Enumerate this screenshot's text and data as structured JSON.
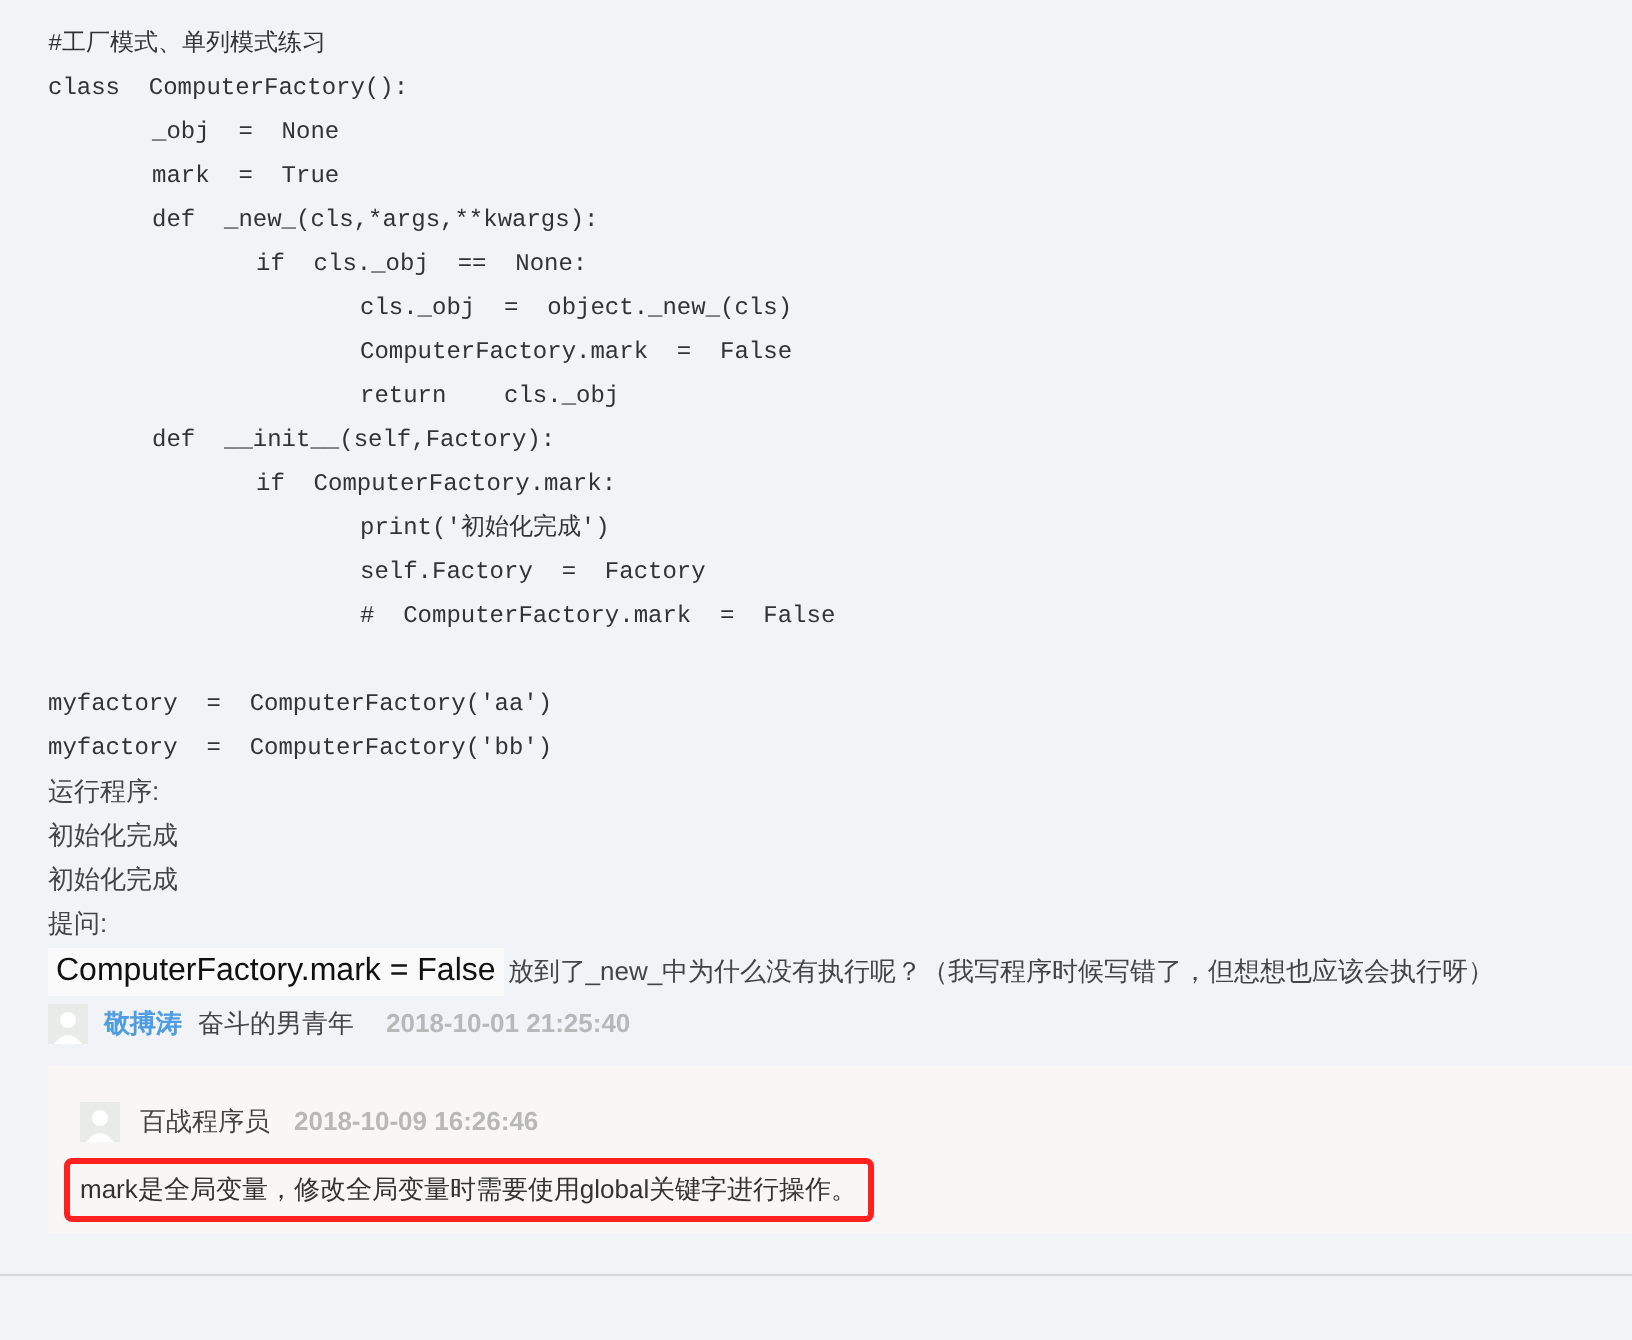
{
  "code_title": "#工厂模式、单列模式练习",
  "code": [
    {
      "text": "class  ComputerFactory():",
      "children": [
        {
          "text": "_obj  =  None"
        },
        {
          "text": "mark  =  True"
        },
        {
          "text": "def  _new_(cls,*args,**kwargs):",
          "children": [
            {
              "text": "if  cls._obj  ==  None:",
              "children": [
                {
                  "text": "cls._obj  =  object._new_(cls)"
                },
                {
                  "text": "ComputerFactory.mark  =  False"
                },
                {
                  "text": "return    cls._obj"
                }
              ]
            }
          ]
        },
        {
          "text": "def  __init__(self,Factory):",
          "children": [
            {
              "text": "if  ComputerFactory.mark:",
              "children": [
                {
                  "text": "print('初始化完成')"
                },
                {
                  "text": "self.Factory  =  Factory"
                },
                {
                  "text": "#  ComputerFactory.mark  =  False"
                }
              ]
            }
          ]
        }
      ]
    }
  ],
  "code_after": [
    "myfactory  =  ComputerFactory('aa')",
    "myfactory  =  ComputerFactory('bb')"
  ],
  "output_lines": [
    "运行程序:",
    "初始化完成",
    "初始化完成",
    "提问:"
  ],
  "question": {
    "highlight": "ComputerFactory.mark = False",
    "text": "放到了_new_中为什么没有执行呢？（我写程序时候写错了，但想想也应该会执行呀）"
  },
  "comment": {
    "author": "敬搏涛",
    "title": "奋斗的男青年",
    "date": "2018-10-01 21:25:40"
  },
  "reply": {
    "author": "百战程序员",
    "date": "2018-10-09 16:26:46",
    "text": "mark是全局变量，修改全局变量时需要使用global关键字进行操作。",
    "highlighted": true
  }
}
